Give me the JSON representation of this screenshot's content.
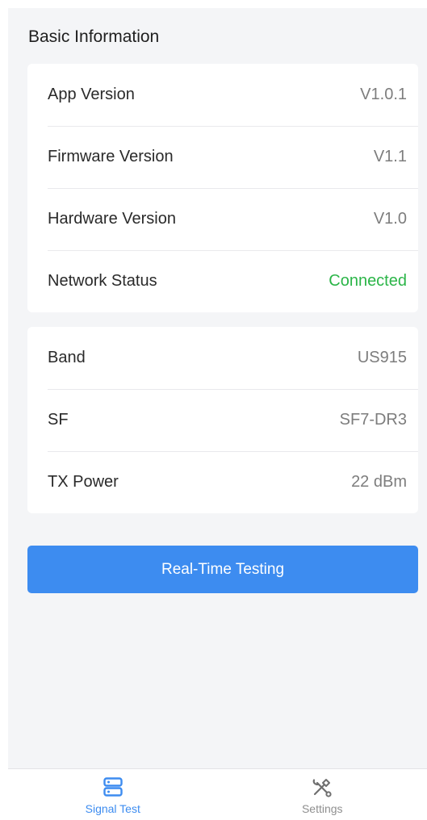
{
  "section_title": "Basic Information",
  "info_rows": [
    {
      "label": "App Version",
      "value": "V1.0.1"
    },
    {
      "label": "Firmware Version",
      "value": "V1.1"
    },
    {
      "label": "Hardware Version",
      "value": "V1.0"
    },
    {
      "label": "Network Status",
      "value": "Connected"
    }
  ],
  "radio_rows": [
    {
      "label": "Band",
      "value": "US915"
    },
    {
      "label": "SF",
      "value": "SF7-DR3"
    },
    {
      "label": "TX Power",
      "value": "22 dBm"
    }
  ],
  "action_button": "Real-Time Testing",
  "tabs": [
    {
      "label": "Signal Test",
      "icon": "server-icon",
      "active": true
    },
    {
      "label": "Settings",
      "icon": "tools-icon",
      "active": false
    }
  ],
  "colors": {
    "accent": "#3d8cf0",
    "status_ok": "#2bb548",
    "background": "#f4f5f7"
  }
}
